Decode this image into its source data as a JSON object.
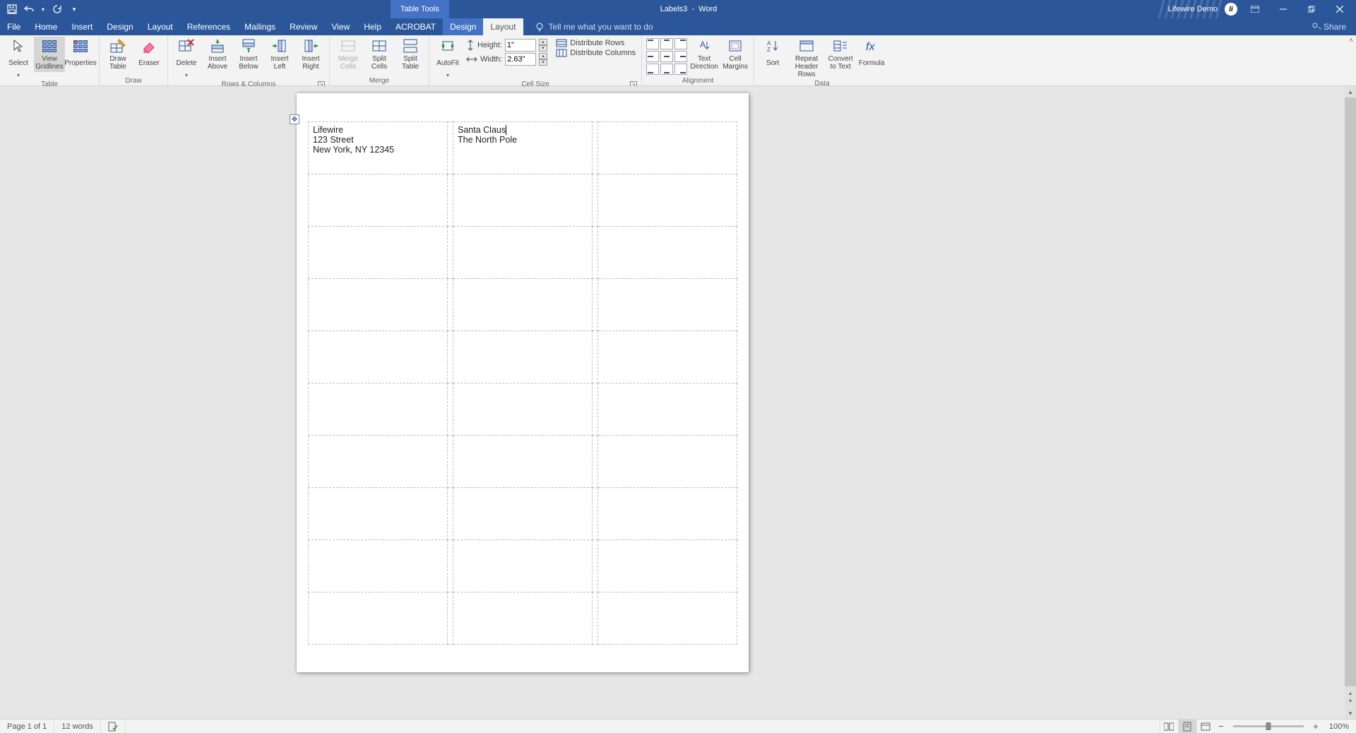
{
  "title": {
    "context_tab": "Table Tools",
    "document": "Labels3",
    "separator": "  -  ",
    "app": "Word",
    "account": "Lifewire Demo"
  },
  "tabs": {
    "file": "File",
    "items": [
      "Home",
      "Insert",
      "Design",
      "Layout",
      "References",
      "Mailings",
      "Review",
      "View",
      "Help",
      "ACROBAT"
    ],
    "context": [
      "Design",
      "Layout"
    ],
    "active": "Layout",
    "tellme": "Tell me what you want to do",
    "share": "Share"
  },
  "ribbon": {
    "groups": {
      "table": {
        "name": "Table",
        "select": "Select",
        "view_gridlines": "View Gridlines",
        "properties": "Properties"
      },
      "draw": {
        "name": "Draw",
        "draw_table": "Draw Table",
        "eraser": "Eraser"
      },
      "rows_cols": {
        "name": "Rows & Columns",
        "delete": "Delete",
        "insert_above": "Insert Above",
        "insert_below": "Insert Below",
        "insert_left": "Insert Left",
        "insert_right": "Insert Right"
      },
      "merge": {
        "name": "Merge",
        "merge_cells": "Merge Cells",
        "split_cells": "Split Cells",
        "split_table": "Split Table"
      },
      "cell_size": {
        "name": "Cell Size",
        "autofit": "AutoFit",
        "height_label": "Height:",
        "height_value": "1\"",
        "width_label": "Width:",
        "width_value": "2.63\"",
        "distribute_rows": "Distribute Rows",
        "distribute_columns": "Distribute Columns"
      },
      "alignment": {
        "name": "Alignment",
        "text_direction": "Text Direction",
        "cell_margins": "Cell Margins"
      },
      "data": {
        "name": "Data",
        "sort": "Sort",
        "repeat_header": "Repeat Header Rows",
        "convert_to_text": "Convert to Text",
        "formula": "Formula"
      }
    }
  },
  "document": {
    "cell_1_1": {
      "line1": "Lifewire",
      "line2": "123 Street",
      "line3": "New York, NY 12345"
    },
    "cell_1_2": {
      "line1": "Santa Claus",
      "line2": "The North Pole"
    }
  },
  "statusbar": {
    "page": "Page 1 of 1",
    "words": "12 words",
    "zoom": "100%"
  }
}
